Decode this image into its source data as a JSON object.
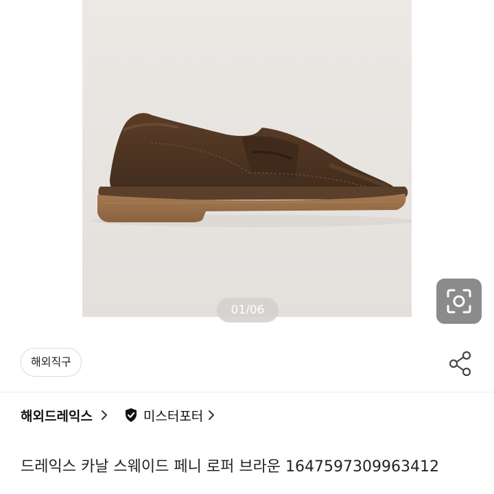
{
  "gallery": {
    "counter": "01/06",
    "image_alt": "brown suede penny loafer",
    "lens_icon": "camera-lens-icon"
  },
  "tags": {
    "shipping_tag": "해외직구"
  },
  "actions": {
    "share_icon": "share-icon"
  },
  "seller": {
    "brand_name": "해외드레익스",
    "badge_icon": "shield-check-icon",
    "badge_label": "미스터포터"
  },
  "product": {
    "title": "드레익스 카날 스웨이드 페니 로퍼 브라운 1647597309963412"
  },
  "colors": {
    "suede": "#4a3220",
    "crepe_sole": "#9a7048",
    "photo_bg": "#e9e6e2"
  }
}
